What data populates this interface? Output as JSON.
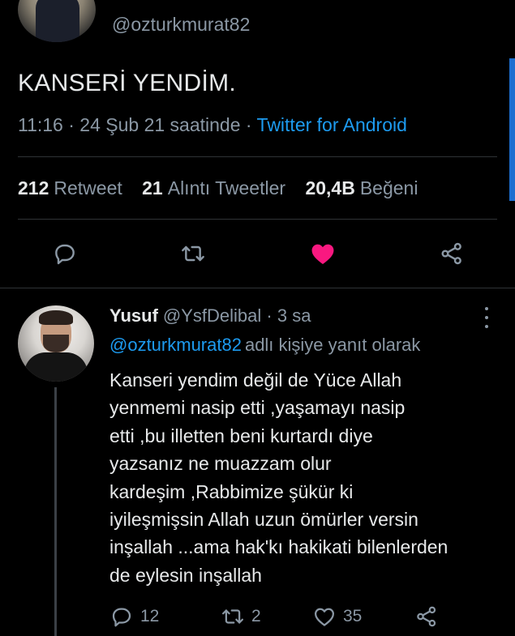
{
  "tweet": {
    "handle": "@ozturkmurat82",
    "text": "KANSERİ YENDİM.",
    "time": "11:16 · 24 Şub 21 saatinde ·",
    "source": "Twitter for Android"
  },
  "stats": {
    "retweets_count": "212",
    "retweets_label": "Retweet",
    "quotes_count": "21",
    "quotes_label": "Alıntı Tweetler",
    "likes_count": "20,4B",
    "likes_label": "Beğeni"
  },
  "actions": {
    "icons": [
      "reply-icon",
      "retweet-icon",
      "like-icon-filled",
      "share-icon"
    ],
    "like_color": "#f91880"
  },
  "reply": {
    "name": "Yusuf",
    "handle": "@YsfDelibal",
    "time": "· 3 sa",
    "reply_to_mention": "@ozturkmurat82",
    "reply_to_suffix": "adlı kişiye yanıt olarak",
    "lines": [
      "Kanseri yendim değil de Yüce Allah",
      "yenmemi nasip etti ,yaşamayı nasip",
      "etti ,bu illetten beni kurtardı diye",
      "yazsanız ne muazzam olur",
      "kardeşim ,Rabbimize şükür ki",
      "iyileşmişsin Allah uzun ömürler versin",
      "inşallah ...ama hak'kı hakikati bilenlerden",
      "de eylesin inşallah"
    ],
    "reply_count": "12",
    "retweet_count": "2",
    "like_count": "35"
  },
  "colors": {
    "background": "#000000",
    "text": "#e7e9ea",
    "muted": "#8b98a5",
    "accent": "#1d9bf0"
  }
}
